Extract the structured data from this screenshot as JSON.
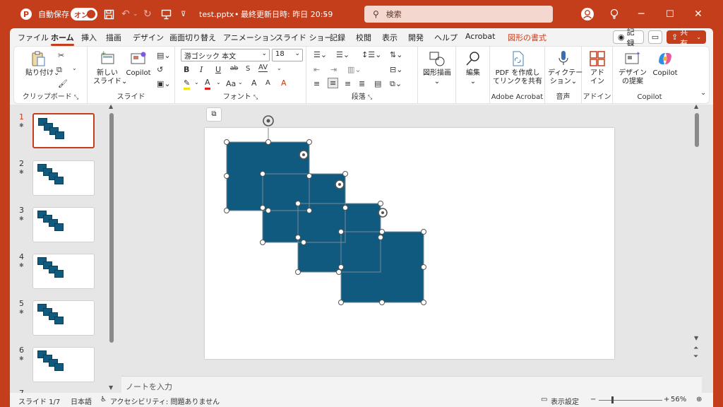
{
  "titlebar": {
    "autosave_label": "自動保存",
    "autosave_state": "オン",
    "filename": "test.pptx",
    "separator": "•",
    "last_modified": "最終更新日時: 昨日 20:59",
    "search_placeholder": "検索"
  },
  "tabs": [
    "ファイル",
    "ホーム",
    "挿入",
    "描画",
    "デザイン",
    "画面切り替え",
    "アニメーション",
    "スライド ショー",
    "記録",
    "校閲",
    "表示",
    "開発",
    "ヘルプ",
    "Acrobat",
    "図形の書式"
  ],
  "active_tab": "ホーム",
  "ribbon_buttons": {
    "record": "記録",
    "share": "共有"
  },
  "ribbon": {
    "clipboard": {
      "paste": "貼り付け",
      "label": "クリップボード"
    },
    "slides": {
      "new_slide_line1": "新しい",
      "new_slide_line2": "スライド",
      "copilot": "Copilot",
      "label": "スライド"
    },
    "font": {
      "font_name": "游ゴシック 本文",
      "font_size": "18",
      "bold": "B",
      "italic": "I",
      "underline": "U",
      "strike": "ab",
      "spacing": "AV",
      "case": "Aa",
      "grow": "A",
      "shrink": "A",
      "clear": "A",
      "label": "フォント"
    },
    "paragraph": {
      "label": "段落"
    },
    "drawing": {
      "shape_draw": "図形描画"
    },
    "editing": {
      "edit": "編集"
    },
    "acrobat": {
      "pdf_line1": "PDF を作成し",
      "pdf_line2": "てリンクを共有",
      "label": "Adobe Acrobat"
    },
    "voice": {
      "dictate_line1": "ディクテー",
      "dictate_line2": "ション",
      "label": "音声"
    },
    "addins": {
      "addin_line1": "アド",
      "addin_line2": "イン",
      "label": "アドイン"
    },
    "copilot": {
      "design_line1": "デザイン",
      "design_line2": "の提案",
      "copilot": "Copilot",
      "label": "Copilot"
    }
  },
  "thumbnails": [
    "1",
    "2",
    "3",
    "4",
    "5",
    "6",
    "7"
  ],
  "active_slide": 1,
  "notes_placeholder": "ノートを入力",
  "status": {
    "slide_info": "スライド 1/7",
    "language": "日本語",
    "accessibility": "アクセシビリティ: 問題ありません",
    "display_settings": "表示設定",
    "zoom": "56%"
  },
  "colors": {
    "accent": "#c43e1c",
    "shape_fill": "#0f5a7e",
    "shape_border": "#0a3f5a"
  }
}
